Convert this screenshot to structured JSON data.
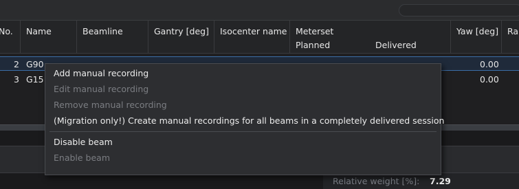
{
  "table": {
    "columns": {
      "no": "No.",
      "name": "Name",
      "beamline": "Beamline",
      "gantry": "Gantry [deg]",
      "isocenter": "Isocenter name",
      "meterset": "Meterset",
      "meterset_planned": "Planned",
      "meterset_delivered": "Delivered",
      "yaw": "Yaw [deg]",
      "ra": "Ra"
    },
    "rows": [
      {
        "no": "2",
        "name": "G90",
        "yaw": "0.00"
      },
      {
        "no": "3",
        "name": "G15",
        "yaw": "0.00"
      }
    ]
  },
  "context_menu": {
    "items": [
      {
        "label": "Add manual recording",
        "enabled": true
      },
      {
        "label": "Edit manual recording",
        "enabled": false
      },
      {
        "label": "Remove manual recording",
        "enabled": false
      },
      {
        "label": "(Migration only!) Create manual recordings for all beams in a completely delivered session",
        "enabled": true
      },
      {
        "label": "Disable beam",
        "enabled": true
      },
      {
        "label": "Enable beam",
        "enabled": false
      }
    ]
  },
  "relative_weight": {
    "label": "Relative weight [%]:",
    "value": "7.29"
  },
  "colors": {
    "background": "#1e1e20",
    "selected_row": "#1f2a3a",
    "selection_border": "#3b6ea8",
    "menu_bg": "#2d2e31",
    "disabled_text": "#7b7d82"
  }
}
